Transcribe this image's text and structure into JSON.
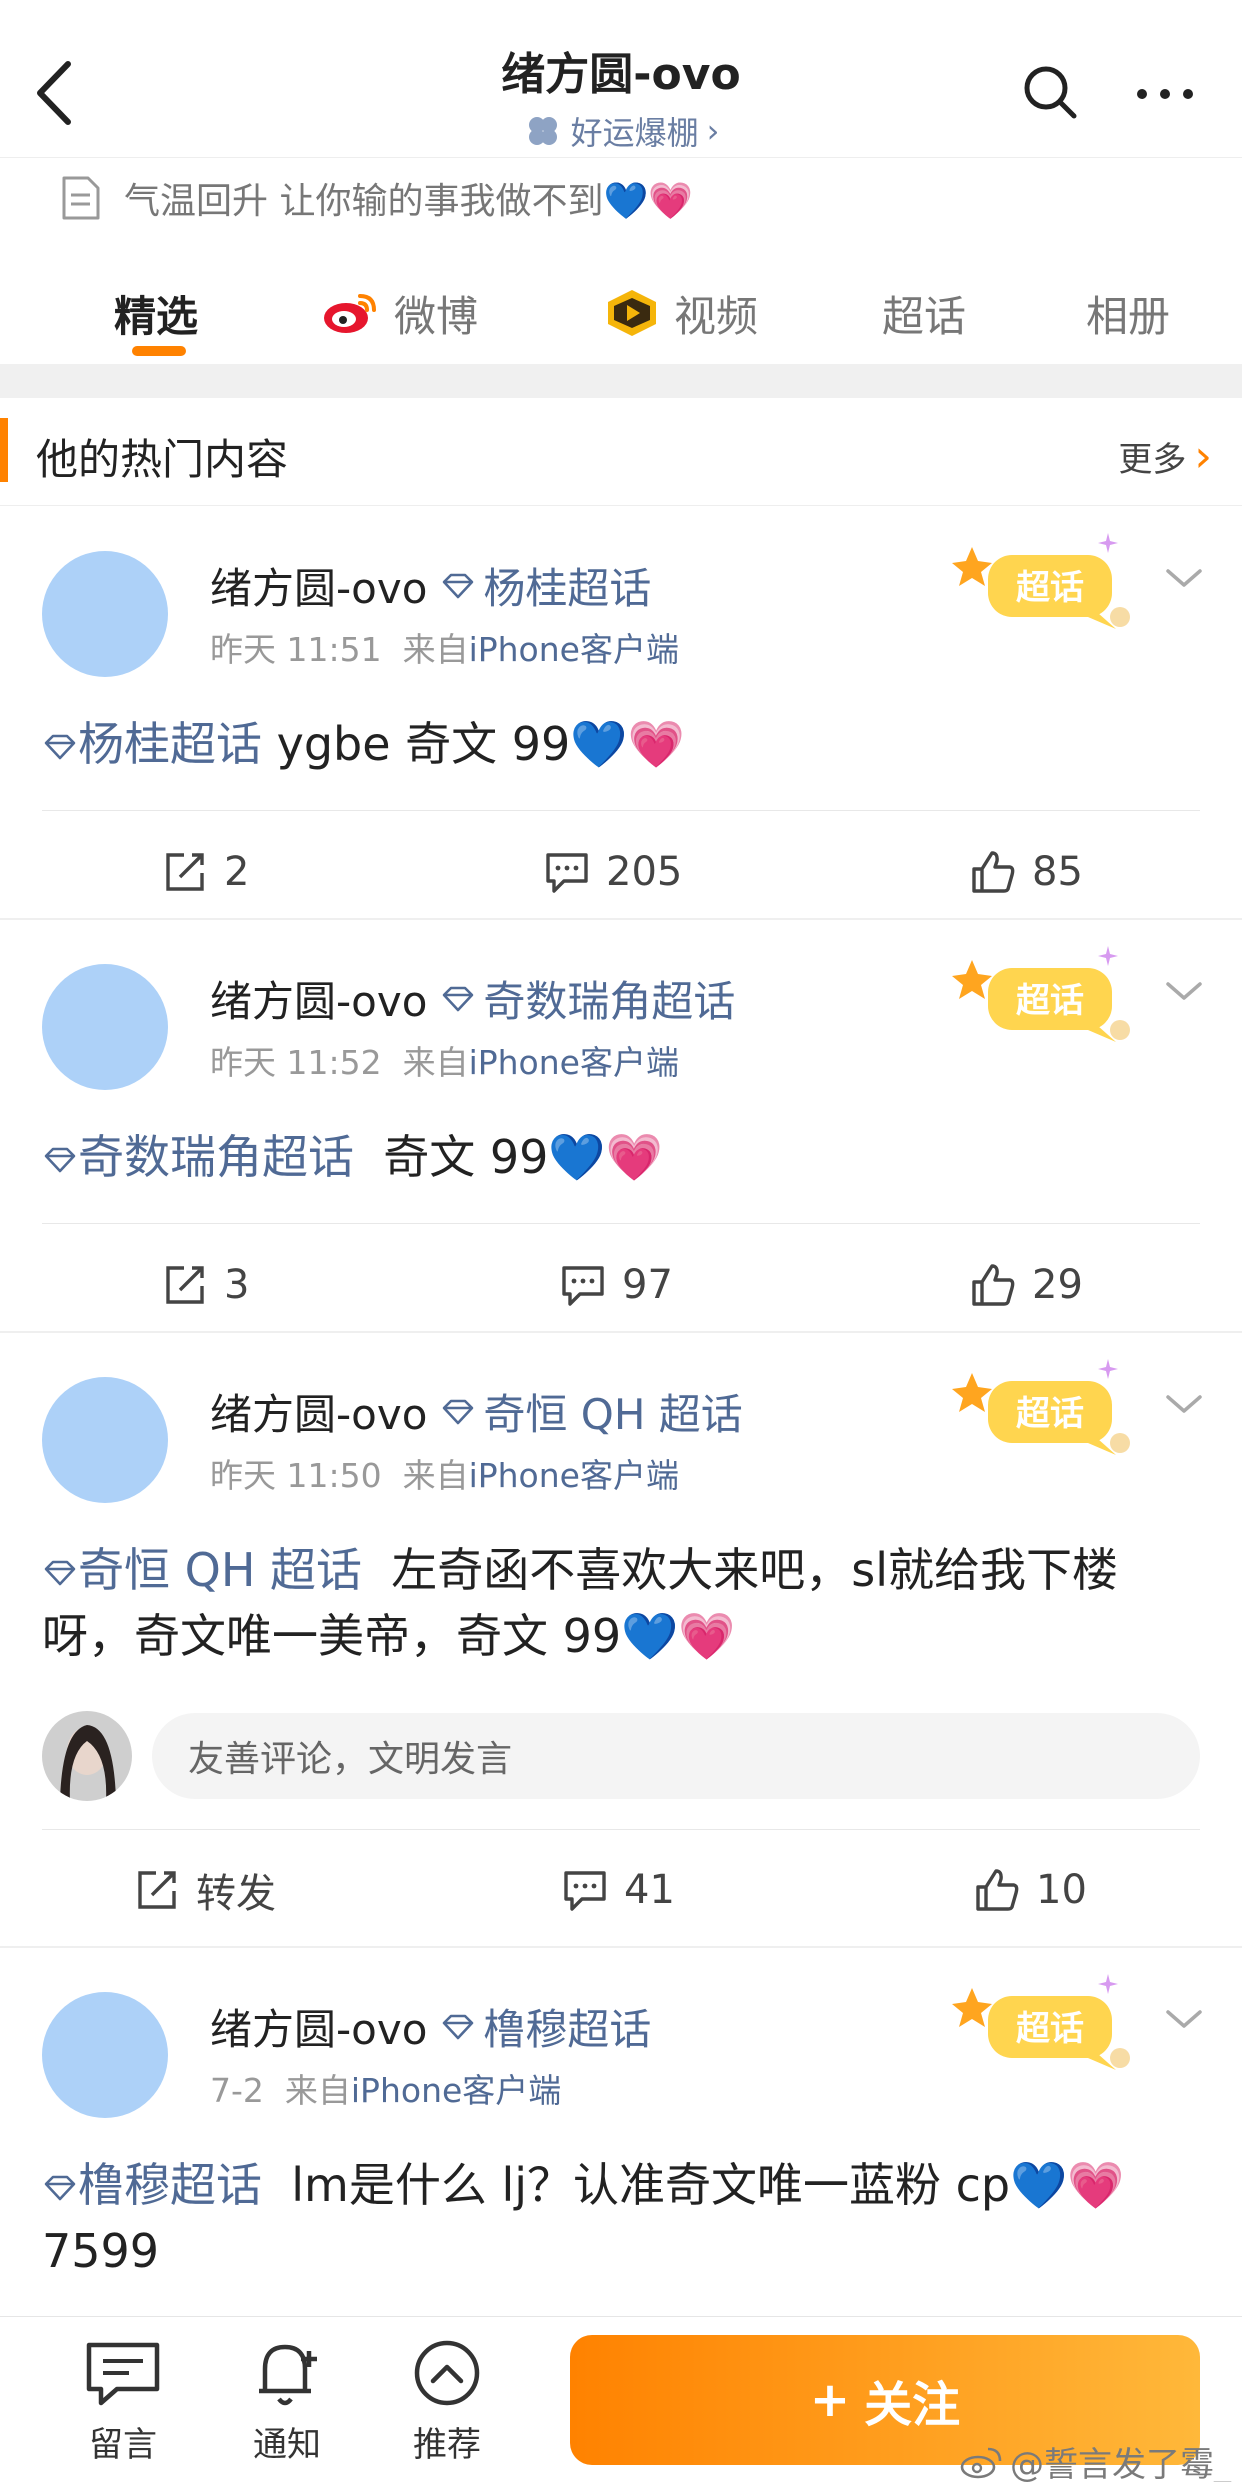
{
  "header": {
    "title": "绪方圆-ovo",
    "subtitle": "好运爆棚",
    "subtitle_chevron": "›",
    "bio": "气温回升 让你输的事我做不到💙💗"
  },
  "tabs": [
    {
      "label": "精选",
      "active": true
    },
    {
      "label": "微博",
      "icon": "weibo-icon"
    },
    {
      "label": "视频",
      "icon": "video-icon"
    },
    {
      "label": "超话"
    },
    {
      "label": "相册"
    }
  ],
  "section": {
    "title": "他的热门内容",
    "more": "更多",
    "more_chevron": "›"
  },
  "sticker_label": "超话",
  "posts": [
    {
      "author": "绪方圆-ovo",
      "topic": "杨桂超话",
      "time": "昨天 11:51",
      "from_label": "来自",
      "source": "iPhone客户端",
      "body_topic": "杨桂超话",
      "body_text": "ygbe 奇文 99💙💗",
      "reposts": "2",
      "comments": "205",
      "likes": "85"
    },
    {
      "author": "绪方圆-ovo",
      "topic": "奇数瑞角超话",
      "time": "昨天 11:52",
      "from_label": "来自",
      "source": "iPhone客户端",
      "body_topic": "奇数瑞角超话",
      "body_text": "奇文 99💙💗",
      "reposts": "3",
      "comments": "97",
      "likes": "29"
    },
    {
      "author": "绪方圆-ovo",
      "topic": "奇恒 QH 超话",
      "time": "昨天 11:50",
      "from_label": "来自",
      "source": "iPhone客户端",
      "body_topic": "奇恒 QH 超话",
      "body_text": "左奇函不喜欢大来吧，sl就给我下楼呀，奇文唯一美帝，奇文 99💙💗",
      "comment_placeholder": "友善评论，文明发言",
      "reposts": "转发",
      "comments": "41",
      "likes": "10"
    },
    {
      "author": "绪方圆-ovo",
      "topic": "橹穆超话",
      "time": "7-2",
      "from_label": "来自",
      "source": "iPhone客户端",
      "body_topic": "橹穆超话",
      "body_text": "lm是什么 lj？认准奇文唯一蓝粉 cp💙💗 7599"
    }
  ],
  "bottom_bar": {
    "message": "留言",
    "notify": "通知",
    "recommend": "推荐",
    "follow_plus": "+",
    "follow": "关注",
    "watermark": "@誓言发了霉_"
  },
  "colors": {
    "accent": "#ff8200",
    "link": "#506a95",
    "avatar_placeholder": "#add1f8"
  }
}
